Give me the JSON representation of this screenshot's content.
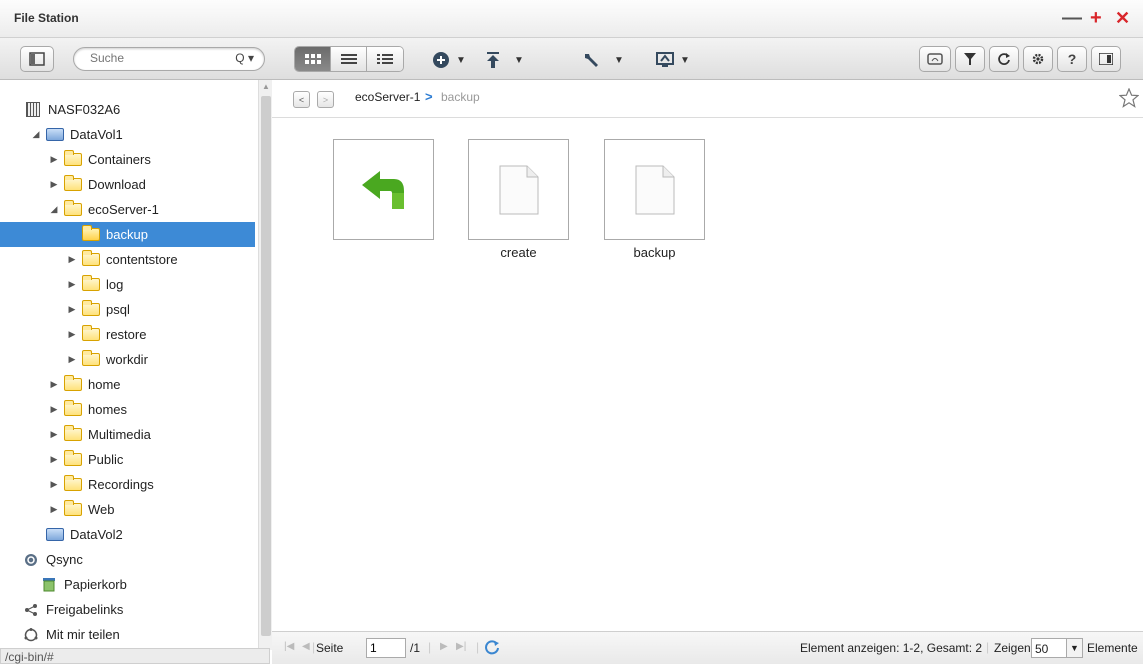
{
  "window": {
    "title": "File Station",
    "minimize": "—",
    "maximize": "+",
    "close": "✕"
  },
  "toolbar": {
    "search_placeholder": "Suche"
  },
  "path": {
    "segments": [
      "ecoServer-1",
      "backup"
    ],
    "separator": ">"
  },
  "sidebar": {
    "root": "NASF032A6",
    "items": [
      {
        "label": "DataVol1",
        "type": "drive",
        "expanded": true
      },
      {
        "label": "Containers",
        "type": "folder"
      },
      {
        "label": "Download",
        "type": "folder"
      },
      {
        "label": "ecoServer-1",
        "type": "folder",
        "expanded": true
      },
      {
        "label": "backup",
        "type": "folder",
        "selected": true
      },
      {
        "label": "contentstore",
        "type": "folder"
      },
      {
        "label": "log",
        "type": "folder"
      },
      {
        "label": "psql",
        "type": "folder"
      },
      {
        "label": "restore",
        "type": "folder"
      },
      {
        "label": "workdir",
        "type": "folder"
      },
      {
        "label": "home",
        "type": "folder"
      },
      {
        "label": "homes",
        "type": "folder"
      },
      {
        "label": "Multimedia",
        "type": "folder"
      },
      {
        "label": "Public",
        "type": "folder"
      },
      {
        "label": "Recordings",
        "type": "folder"
      },
      {
        "label": "Web",
        "type": "folder"
      },
      {
        "label": "DataVol2",
        "type": "drive"
      },
      {
        "label": "Qsync",
        "type": "qsync"
      },
      {
        "label": "Papierkorb",
        "type": "trash"
      },
      {
        "label": "Freigabelinks",
        "type": "share"
      },
      {
        "label": "Mit mir teilen",
        "type": "shared"
      }
    ]
  },
  "files": [
    {
      "name": "",
      "type": "up"
    },
    {
      "name": "create",
      "type": "file"
    },
    {
      "name": "backup",
      "type": "file"
    }
  ],
  "status": {
    "page_label": "Seite",
    "page_value": "1",
    "page_total": "/1",
    "summary": "Element anzeigen: 1-2, Gesamt: 2",
    "show_label": "Zeigen",
    "show_value": "50",
    "items_label": "Elemente"
  },
  "url_hint": "/cgi-bin/#",
  "colors": {
    "accent": "#3d8ad6",
    "close": "#d9262b",
    "plus": "#d9262b",
    "up_arrow": "#4aa820"
  }
}
